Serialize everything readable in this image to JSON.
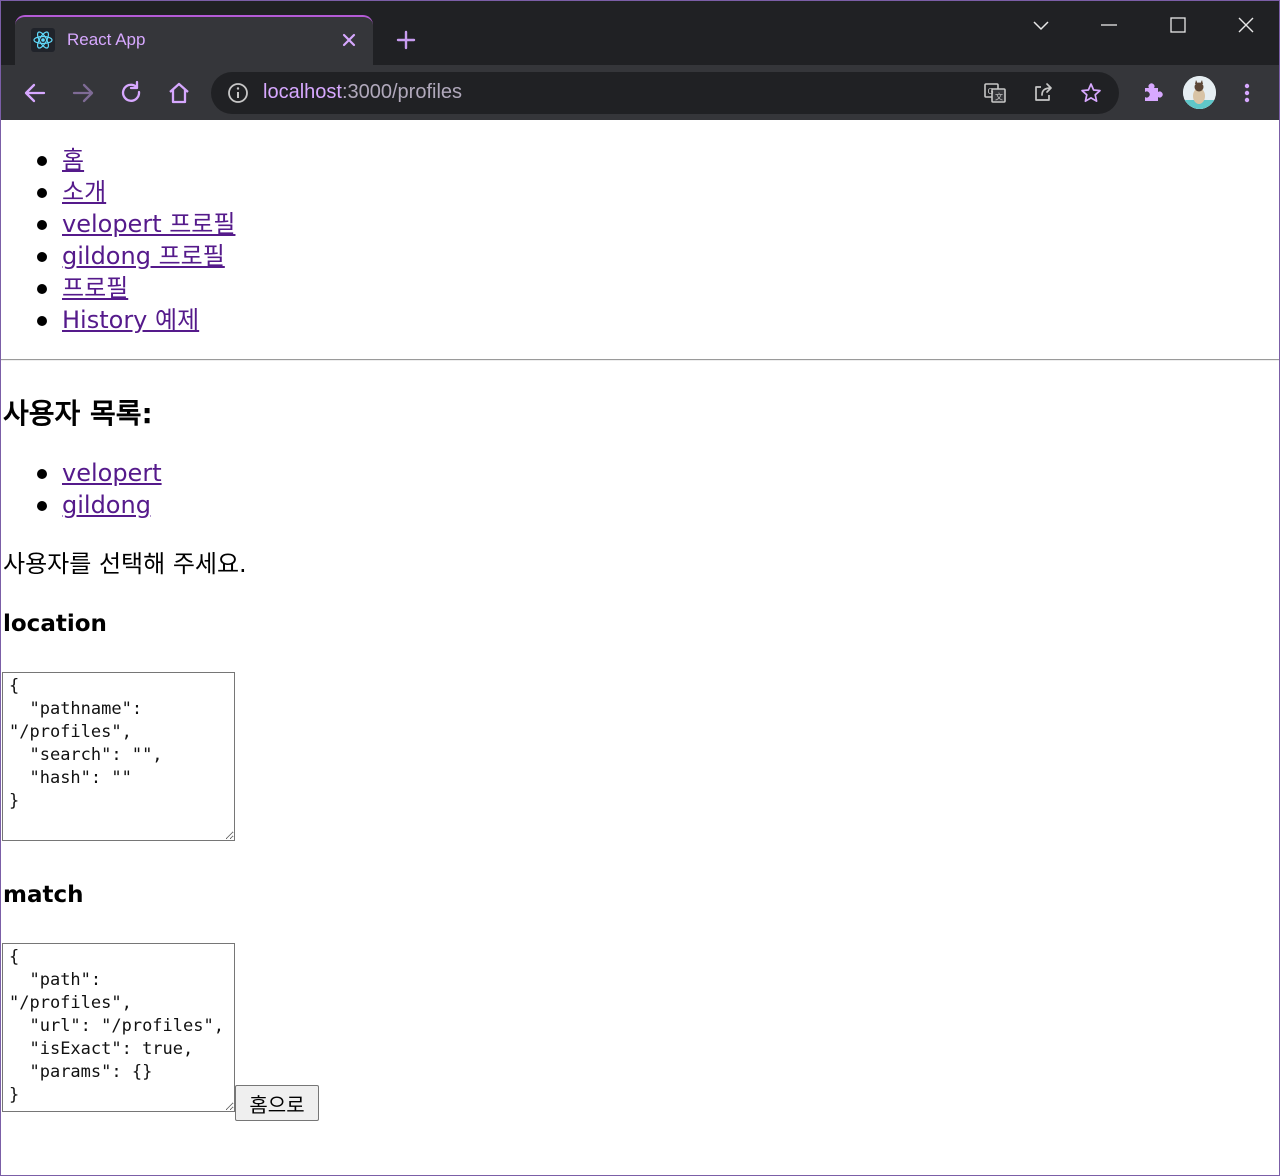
{
  "browser": {
    "tab_title": "React App",
    "url_host": "localhost",
    "url_path": ":3000/profiles"
  },
  "colors": {
    "accent": "#d7a8ff",
    "chrome_bg": "#202124",
    "toolbar_bg": "#35363a",
    "link": "#551a8b"
  },
  "nav": {
    "items": [
      {
        "label": "홈"
      },
      {
        "label": "소개"
      },
      {
        "label": "velopert 프로필"
      },
      {
        "label": "gildong 프로필"
      },
      {
        "label": "프로필"
      },
      {
        "label": "History 예제"
      }
    ]
  },
  "profiles": {
    "heading": "사용자 목록:",
    "users": [
      "velopert",
      "gildong"
    ],
    "select_message": "사용자를 선택해 주세요."
  },
  "location": {
    "heading": "location",
    "json_text": "{\n  \"pathname\": \"/profiles\",\n  \"search\": \"\",\n  \"hash\": \"\"\n}"
  },
  "match": {
    "heading": "match",
    "json_text": "{\n  \"path\": \"/profiles\",\n  \"url\": \"/profiles\",\n  \"isExact\": true,\n  \"params\": {}\n}"
  },
  "home_button_label": "홈으로",
  "icons": [
    "react-icon",
    "close-icon",
    "plus-icon",
    "chevron-down-icon",
    "minimize-icon",
    "maximize-icon",
    "window-close-icon",
    "back-arrow-icon",
    "forward-arrow-icon",
    "reload-icon",
    "home-icon",
    "info-icon",
    "translate-icon",
    "share-icon",
    "star-icon",
    "puzzle-icon",
    "kebab-menu-icon"
  ]
}
